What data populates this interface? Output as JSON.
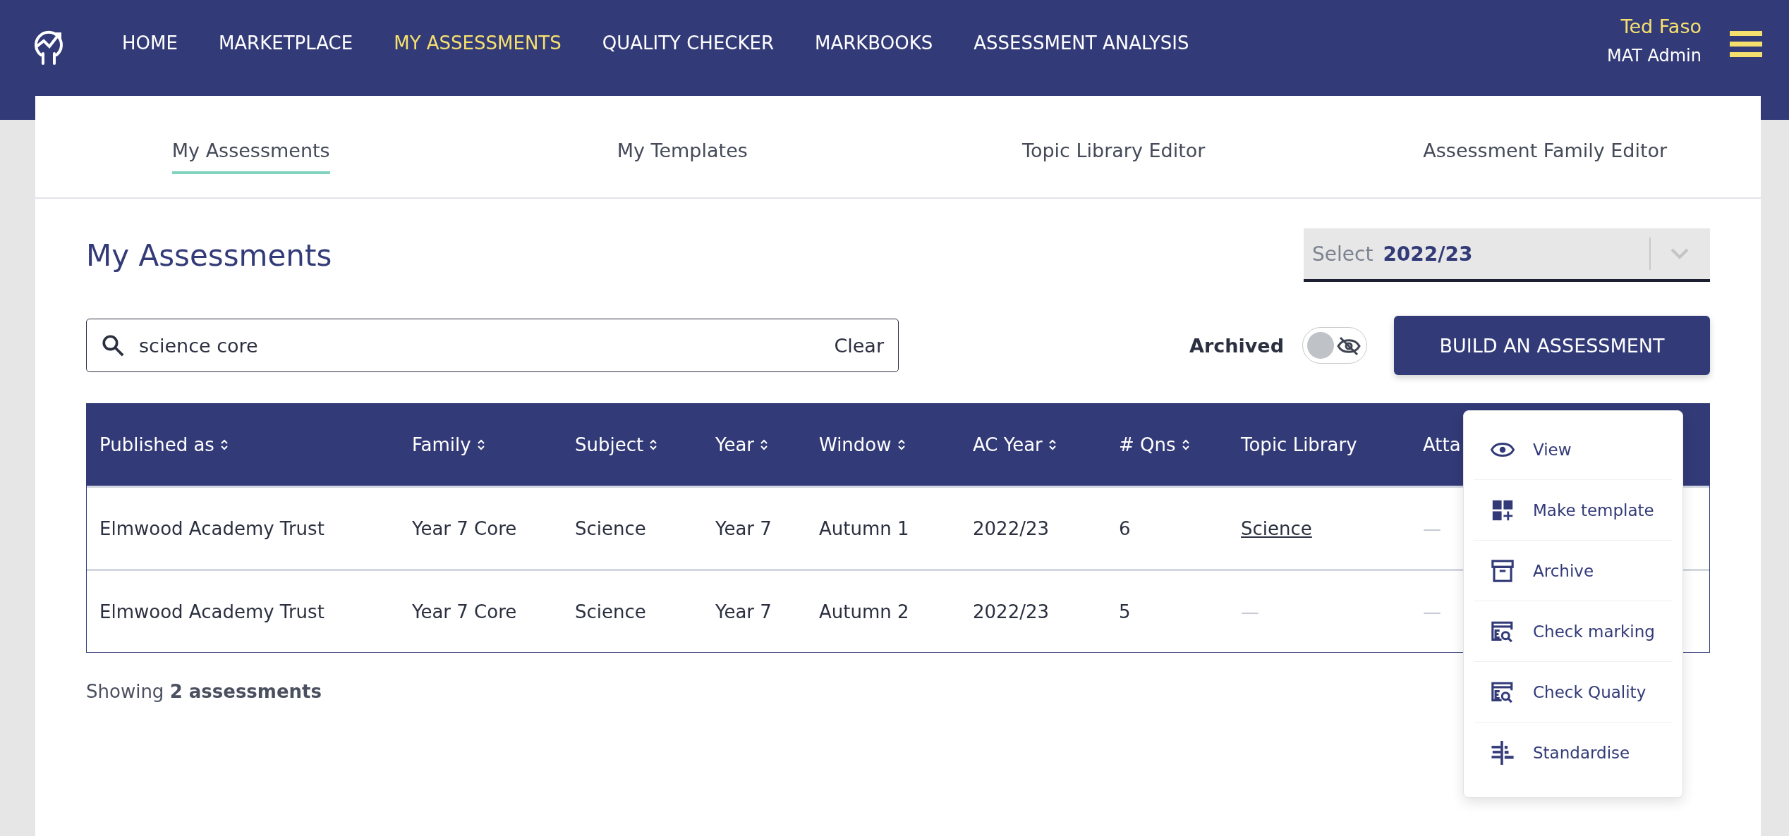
{
  "nav": {
    "items": [
      {
        "label": "HOME",
        "selected": false
      },
      {
        "label": "MARKETPLACE",
        "selected": false
      },
      {
        "label": "MY ASSESSMENTS",
        "selected": true
      },
      {
        "label": "QUALITY CHECKER",
        "selected": false
      },
      {
        "label": "MARKBOOKS",
        "selected": false
      },
      {
        "label": "ASSESSMENT ANALYSIS",
        "selected": false
      }
    ],
    "user": {
      "name": "Ted Faso",
      "role": "MAT Admin"
    }
  },
  "tabs": [
    {
      "label": "My Assessments",
      "selected": true
    },
    {
      "label": "My Templates",
      "selected": false
    },
    {
      "label": "Topic Library Editor",
      "selected": false
    },
    {
      "label": "Assessment Family Editor",
      "selected": false
    }
  ],
  "page_title": "My Assessments",
  "year_select": {
    "placeholder": "Select",
    "value": "2022/23"
  },
  "search": {
    "value": "science core",
    "clear": "Clear"
  },
  "archived_toggle": {
    "label": "Archived",
    "on": false
  },
  "build_button": "BUILD AN ASSESSMENT",
  "table": {
    "columns": [
      {
        "label": "Published as",
        "sortable": true
      },
      {
        "label": "Family",
        "sortable": true
      },
      {
        "label": "Subject",
        "sortable": true
      },
      {
        "label": "Year",
        "sortable": true
      },
      {
        "label": "Window",
        "sortable": true
      },
      {
        "label": "AC Year",
        "sortable": true
      },
      {
        "label": "# Qns",
        "sortable": true
      },
      {
        "label": "Topic Library",
        "sortable": false
      },
      {
        "label": "Atta",
        "sortable": false
      }
    ],
    "rows": [
      {
        "cells": [
          {
            "text": "Elmwood Academy Trust",
            "kind": "text"
          },
          {
            "text": "Year 7 Core",
            "kind": "text"
          },
          {
            "text": "Science",
            "kind": "text"
          },
          {
            "text": "Year 7",
            "kind": "text"
          },
          {
            "text": "Autumn 1",
            "kind": "text"
          },
          {
            "text": "2022/23",
            "kind": "text"
          },
          {
            "text": "6",
            "kind": "text"
          },
          {
            "text": "Science",
            "kind": "link"
          },
          {
            "text": "—",
            "kind": "empty"
          }
        ]
      },
      {
        "cells": [
          {
            "text": "Elmwood Academy Trust",
            "kind": "text"
          },
          {
            "text": "Year 7 Core",
            "kind": "text"
          },
          {
            "text": "Science",
            "kind": "text"
          },
          {
            "text": "Year 7",
            "kind": "text"
          },
          {
            "text": "Autumn 2",
            "kind": "text"
          },
          {
            "text": "2022/23",
            "kind": "text"
          },
          {
            "text": "5",
            "kind": "text"
          },
          {
            "text": "—",
            "kind": "empty"
          },
          {
            "text": "—",
            "kind": "empty"
          }
        ]
      }
    ]
  },
  "footer": "Showing **2 assessments**",
  "menu": [
    {
      "label": "View",
      "kind": "view"
    },
    {
      "label": "Make template",
      "kind": "template"
    },
    {
      "label": "Archive",
      "kind": "archive"
    },
    {
      "label": "Check marking",
      "kind": "check"
    },
    {
      "label": "Check Quality",
      "kind": "check"
    },
    {
      "label": "Standardise",
      "kind": "standardise"
    }
  ]
}
